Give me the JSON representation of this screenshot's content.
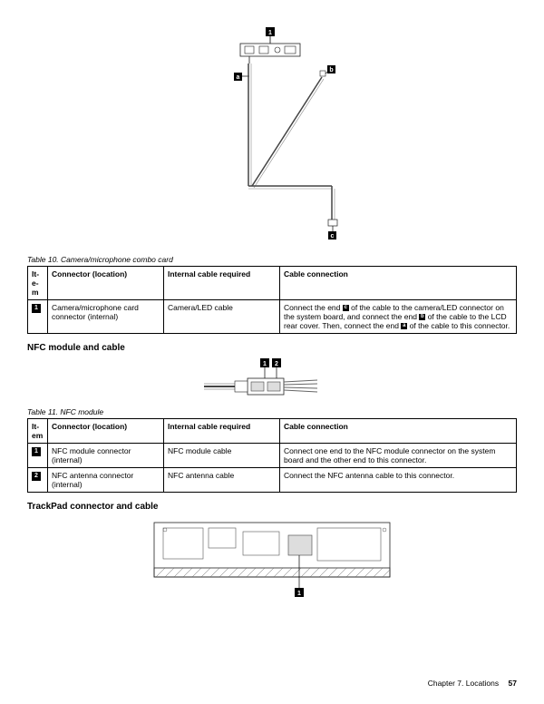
{
  "diagram1": {
    "callouts": {
      "top": "1",
      "a": "a",
      "b": "b",
      "c": "c"
    }
  },
  "table10": {
    "caption": "Table 10.  Camera/microphone combo card",
    "headers": {
      "item": "It-\ne-\nm",
      "connector": "Connector (location)",
      "cable": "Internal cable required",
      "connection": "Cable connection"
    },
    "rows": [
      {
        "item": "1",
        "connector": "Camera/microphone card connector (internal)",
        "cable": "Camera/LED cable",
        "connection_pre": "Connect the end ",
        "connection_c": "c",
        "connection_mid1": " of the cable to the camera/LED connector on the system board, and connect the end ",
        "connection_b": "b",
        "connection_mid2": " of the cable to the LCD rear cover. Then, connect the end ",
        "connection_a": "a",
        "connection_post": " of the cable to this connector."
      }
    ]
  },
  "section_nfc": "NFC module and cable",
  "diagram2": {
    "callouts": {
      "one": "1",
      "two": "2"
    }
  },
  "table11": {
    "caption": "Table 11.  NFC module",
    "headers": {
      "item": "It-\nem",
      "connector": "Connector (location)",
      "cable": "Internal cable required",
      "connection": "Cable connection"
    },
    "rows": [
      {
        "item": "1",
        "connector": "NFC module connector (internal)",
        "cable": "NFC module cable",
        "connection": "Connect one end to the NFC module connector on the system board and the other end to this connector."
      },
      {
        "item": "2",
        "connector": "NFC antenna connector (internal)",
        "cable": "NFC antenna cable",
        "connection": "Connect the NFC antenna cable to this connector."
      }
    ]
  },
  "section_trackpad": "TrackPad connector and cable",
  "diagram3": {
    "callout": "1"
  },
  "footer": {
    "chapter": "Chapter 7.  Locations",
    "page": "57"
  }
}
